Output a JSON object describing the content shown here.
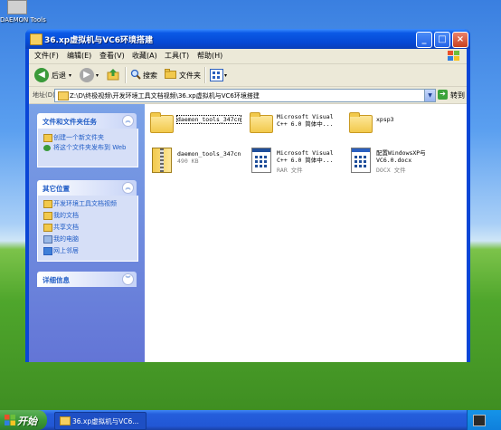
{
  "desktop": {
    "icon_label": "DAEMON Tools"
  },
  "window": {
    "title": "36.xp虚拟机与VC6环境搭建",
    "buttons": {
      "minimize": "_",
      "maximize": "□",
      "close": "×"
    }
  },
  "menu": [
    "文件(F)",
    "编辑(E)",
    "查看(V)",
    "收藏(A)",
    "工具(T)",
    "帮助(H)"
  ],
  "toolbar": {
    "back": "后退",
    "search": "搜索",
    "folders": "文件夹"
  },
  "address": {
    "label": "地址(D)",
    "path": "Z:\\D\\终极视频\\开发环境工具文档视频\\36.xp虚拟机与VC6环境搭建",
    "go": "转到"
  },
  "sidebar": {
    "panels": [
      {
        "title": "文件和文件夹任务",
        "toggle": "︽",
        "items": [
          "创建一个新文件夹",
          "将这个文件夹发布到 Web"
        ]
      },
      {
        "title": "其它位置",
        "toggle": "︽",
        "items": [
          "开发环境工具文档视频",
          "我的文档",
          "共享文档",
          "我的电脑",
          "网上邻居"
        ]
      },
      {
        "title": "详细信息",
        "toggle": "︾",
        "items": []
      }
    ]
  },
  "files": [
    {
      "name": "daemon_tools_347cn",
      "sub": "",
      "type": "folder"
    },
    {
      "name": "Microsoft Visual C++ 6.0 简体中...",
      "sub": "",
      "type": "folder"
    },
    {
      "name": "xpsp3",
      "sub": "",
      "type": "folder"
    },
    {
      "name": "daemon_tools_347cn",
      "sub": "490 KB",
      "type": "zip"
    },
    {
      "name": "Microsoft Visual C++ 6.0 简体中...",
      "sub": "RAR 文件",
      "type": "rar"
    },
    {
      "name": "配置WindowsXP与VC6.0.docx",
      "sub": "DOCX 文件",
      "type": "docx"
    }
  ],
  "taskbar": {
    "start": "开始",
    "task": "36.xp虚拟机与VC6..."
  }
}
